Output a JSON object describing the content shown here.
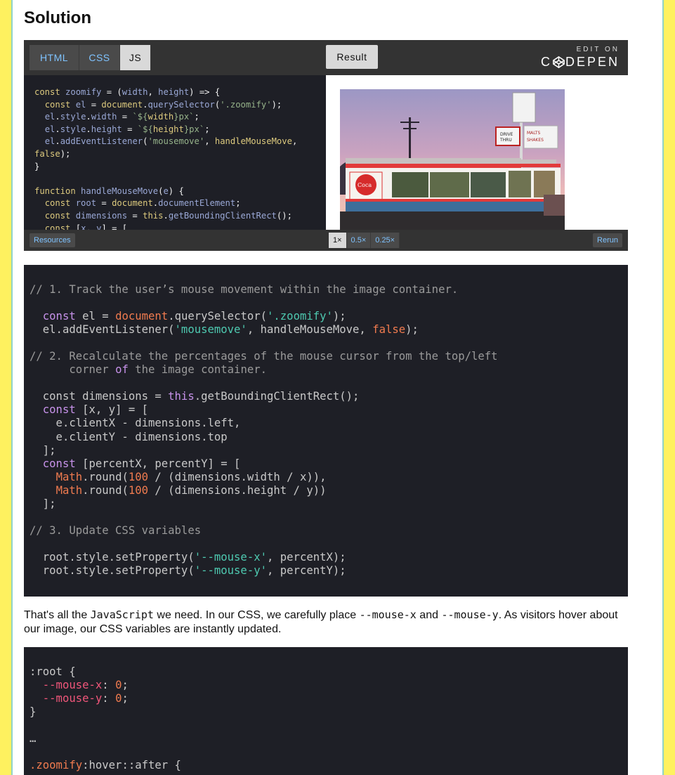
{
  "heading": "Solution",
  "pen": {
    "tabs": [
      "HTML",
      "CSS",
      "JS"
    ],
    "active_tab": "JS",
    "result_label": "Result",
    "edit_on": "EDIT ON",
    "brand": "CODEPEN",
    "resources_label": "Resources",
    "zoom_options": [
      "1×",
      "0.5×",
      "0.25×"
    ],
    "rerun_label": "Rerun",
    "image_alt": "Diner with Coca-Cola sign and 'Drive Thru' sign at dusk"
  },
  "code1_lines": [
    "// 1. Track the user’s mouse movement within the image container.",
    "const el = document.querySelector('.zoomify');",
    "el.addEventListener('mousemove', handleMouseMove, false);",
    "// 2. Recalculate the percentages of the mouse cursor from the top/left corner of the image container.",
    "const dimensions = this.getBoundingClientRect();",
    "// 3. Update CSS variables"
  ],
  "paragraph": {
    "text1": "That's all the ",
    "code1": "JavaScript",
    "text2": " we need. In our CSS, we carefully place ",
    "code2": "--mouse-x",
    "text3": " and ",
    "code3": "--mouse-y",
    "text4": ". As visitors hover about our image, our CSS variables are instantly updated."
  }
}
